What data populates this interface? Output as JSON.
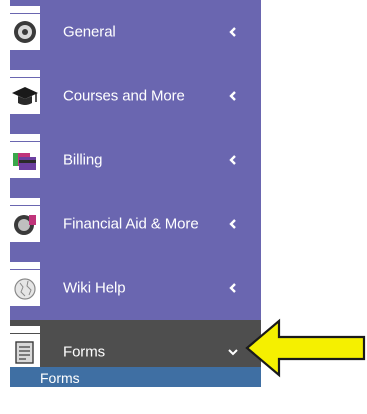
{
  "sidebar": {
    "items": [
      {
        "label": "General",
        "icon": "gear-icon",
        "state": "collapsed"
      },
      {
        "label": "Courses and More",
        "icon": "graduation-cap-icon",
        "state": "collapsed"
      },
      {
        "label": "Billing",
        "icon": "credit-card-icon",
        "state": "collapsed"
      },
      {
        "label": "Financial Aid & More",
        "icon": "financial-aid-icon",
        "state": "collapsed"
      },
      {
        "label": "Wiki Help",
        "icon": "wiki-globe-icon",
        "state": "collapsed"
      },
      {
        "label": "Forms",
        "icon": "document-form-icon",
        "state": "expanded"
      }
    ],
    "submenu": {
      "label": "Forms"
    }
  },
  "colors": {
    "sidebar_bg": "#6a66b0",
    "active_bg": "#4e4e4e",
    "submenu_bg": "#3f6fa3",
    "arrow_fill": "#f5f000"
  }
}
